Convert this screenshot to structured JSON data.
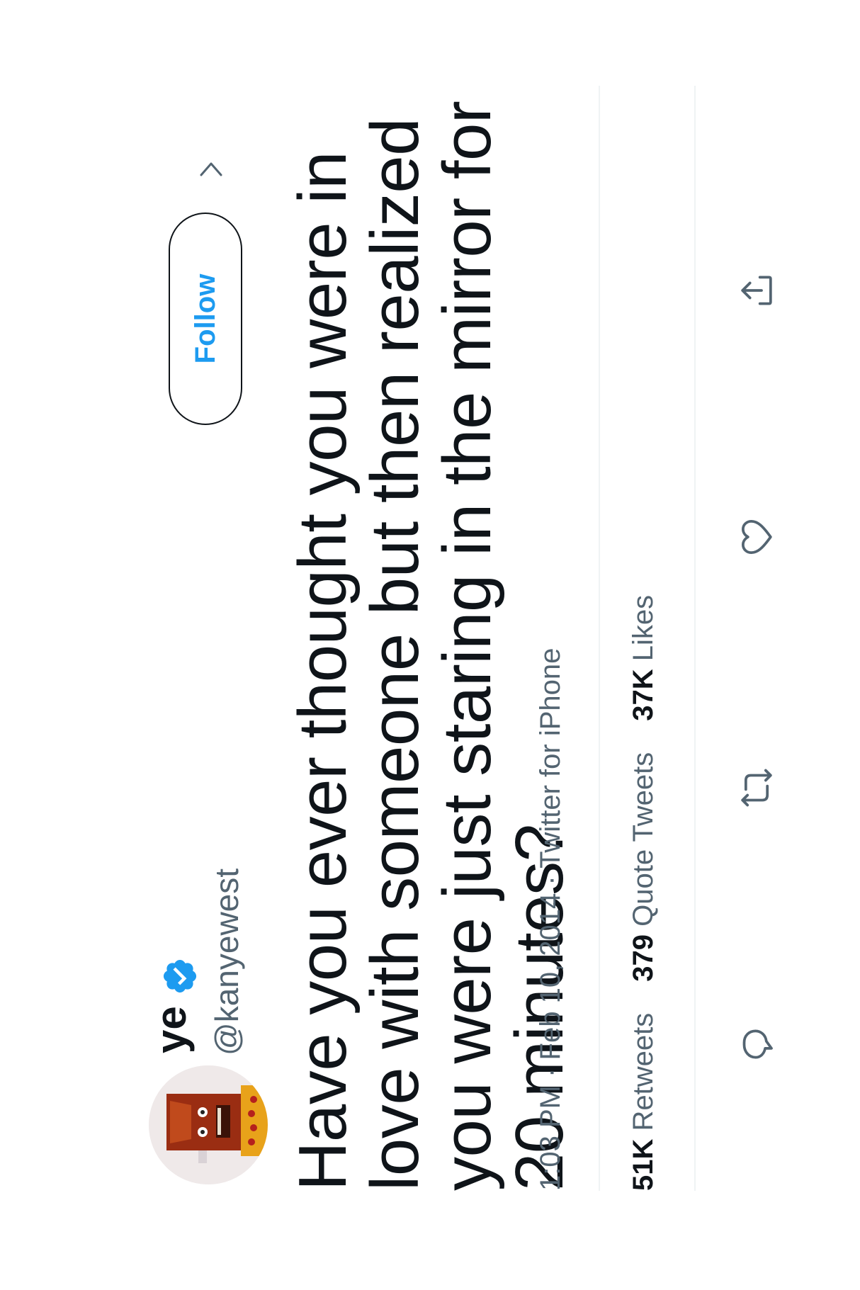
{
  "user": {
    "display_name": "ye",
    "handle": "@kanyewest",
    "verified": true
  },
  "follow_button": {
    "label": "Follow"
  },
  "tweet": {
    "text": "Have you ever thought you were in love with someone but then realized you were just staring in the mirror for 20 minutes?",
    "time": "1:03 PM",
    "separator": "·",
    "date": "Feb 10, 2014",
    "source": "Twitter for iPhone"
  },
  "stats": {
    "retweets_count": "51K",
    "retweets_label": "Retweets",
    "quotes_count": "379",
    "quotes_label": "Quote Tweets",
    "likes_count": "37K",
    "likes_label": "Likes"
  },
  "actions": {
    "reply_icon": "reply-icon",
    "retweet_icon": "retweet-icon",
    "like_icon": "heart-icon",
    "share_icon": "share-icon"
  },
  "colors": {
    "accent": "#1d9bf0",
    "text_primary": "#0f1419",
    "text_secondary": "#536471",
    "divider": "#eff3f4"
  }
}
